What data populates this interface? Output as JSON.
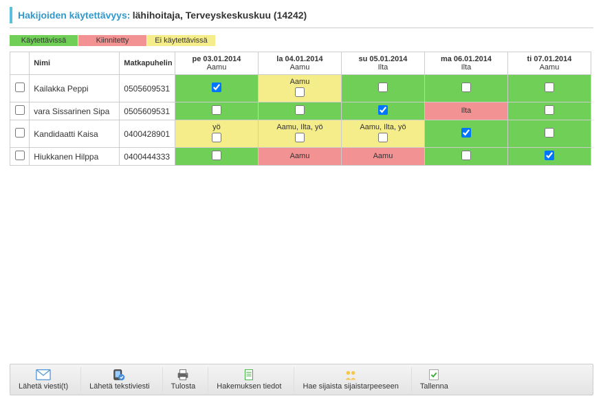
{
  "header": {
    "label": "Hakijoiden käytettävyys:",
    "value": "lähihoitaja, Terveyskeskuskuu (14242)"
  },
  "legend": {
    "available": "Käytettävissä",
    "pinned": "Kiinnitetty",
    "unavailable": "Ei käytettävissä"
  },
  "columns": {
    "name": "Nimi",
    "phone": "Matkapuhelin",
    "days": [
      {
        "date": "pe 03.01.2014",
        "sub": "Aamu"
      },
      {
        "date": "la 04.01.2014",
        "sub": "Aamu"
      },
      {
        "date": "su 05.01.2014",
        "sub": "Ilta"
      },
      {
        "date": "ma 06.01.2014",
        "sub": "Ilta"
      },
      {
        "date": "ti 07.01.2014",
        "sub": "Aamu"
      }
    ]
  },
  "rows": [
    {
      "selected": false,
      "name": "Kailakka Peppi",
      "phone": "0505609531",
      "cells": [
        {
          "status": "avail",
          "note": "",
          "checkbox": true,
          "checked": true
        },
        {
          "status": "unavail",
          "note": "Aamu",
          "checkbox": true,
          "checked": false
        },
        {
          "status": "avail",
          "note": "",
          "checkbox": true,
          "checked": false
        },
        {
          "status": "avail",
          "note": "",
          "checkbox": true,
          "checked": false
        },
        {
          "status": "avail",
          "note": "",
          "checkbox": true,
          "checked": false
        }
      ]
    },
    {
      "selected": false,
      "name": "vara Sissarinen Sipa",
      "phone": "0505609531",
      "cells": [
        {
          "status": "avail",
          "note": "",
          "checkbox": true,
          "checked": false
        },
        {
          "status": "avail",
          "note": "",
          "checkbox": true,
          "checked": false
        },
        {
          "status": "avail",
          "note": "",
          "checkbox": true,
          "checked": true
        },
        {
          "status": "pinned",
          "note": "Ilta",
          "checkbox": false,
          "checked": false
        },
        {
          "status": "avail",
          "note": "",
          "checkbox": true,
          "checked": false
        }
      ]
    },
    {
      "selected": false,
      "name": "Kandidaatti Kaisa",
      "phone": "0400428901",
      "cells": [
        {
          "status": "unavail",
          "note": "yö",
          "checkbox": true,
          "checked": false
        },
        {
          "status": "unavail",
          "note": "Aamu, Ilta, yö",
          "checkbox": true,
          "checked": false
        },
        {
          "status": "unavail",
          "note": "Aamu, Ilta, yö",
          "checkbox": true,
          "checked": false
        },
        {
          "status": "avail",
          "note": "",
          "checkbox": true,
          "checked": true
        },
        {
          "status": "avail",
          "note": "",
          "checkbox": true,
          "checked": false
        }
      ]
    },
    {
      "selected": false,
      "name": "Hiukkanen Hilppa",
      "phone": "0400444333",
      "cells": [
        {
          "status": "avail",
          "note": "",
          "checkbox": true,
          "checked": false
        },
        {
          "status": "pinned",
          "note": "Aamu",
          "checkbox": false,
          "checked": false
        },
        {
          "status": "pinned",
          "note": "Aamu",
          "checkbox": false,
          "checked": false
        },
        {
          "status": "avail",
          "note": "",
          "checkbox": true,
          "checked": false
        },
        {
          "status": "avail",
          "note": "",
          "checkbox": true,
          "checked": true
        }
      ]
    }
  ],
  "toolbar": [
    {
      "id": "send-message",
      "label": "Lähetä viesti(t)",
      "icon": "mail-icon"
    },
    {
      "id": "send-sms",
      "label": "Lähetä tekstiviesti",
      "icon": "sms-icon"
    },
    {
      "id": "print",
      "label": "Tulosta",
      "icon": "printer-icon"
    },
    {
      "id": "application-details",
      "label": "Hakemuksen tiedot",
      "icon": "document-icon"
    },
    {
      "id": "find-substitute",
      "label": "Hae sijaista sijaistarpeeseen",
      "icon": "people-icon"
    },
    {
      "id": "save",
      "label": "Tallenna",
      "icon": "save-icon"
    }
  ]
}
